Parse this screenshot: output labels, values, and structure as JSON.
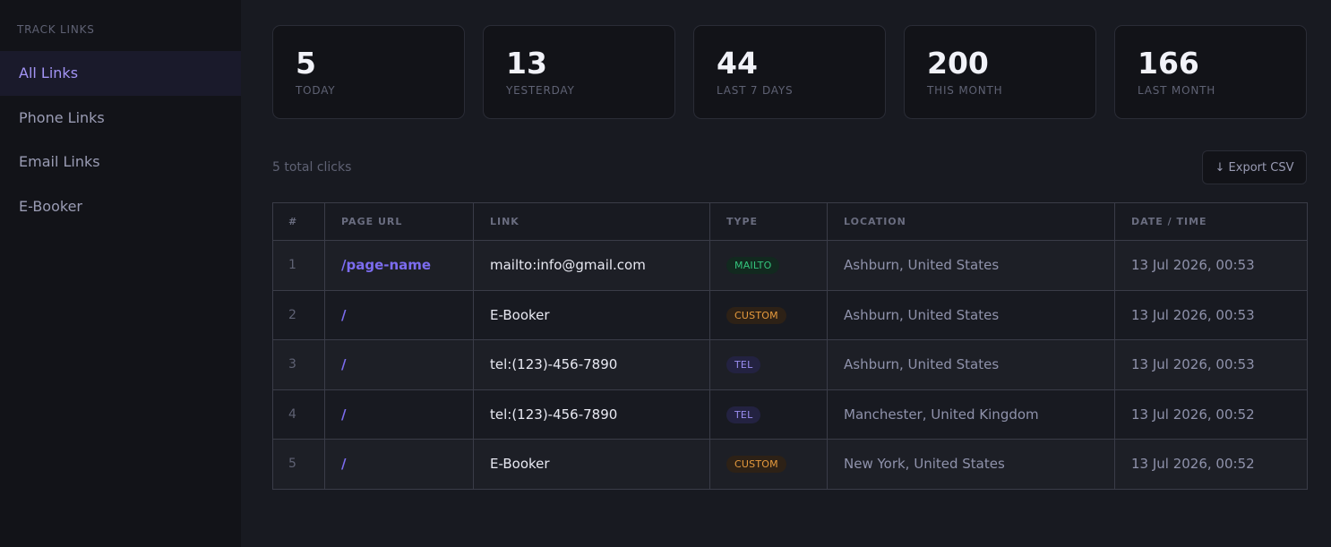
{
  "sidebar": {
    "heading": "TRACK LINKS",
    "items": [
      {
        "label": "All Links",
        "active": true
      },
      {
        "label": "Phone Links",
        "active": false
      },
      {
        "label": "Email Links",
        "active": false
      },
      {
        "label": "E-Booker",
        "active": false
      }
    ]
  },
  "stats": [
    {
      "value": "5",
      "label": "TODAY"
    },
    {
      "value": "13",
      "label": "YESTERDAY"
    },
    {
      "value": "44",
      "label": "LAST 7 DAYS"
    },
    {
      "value": "200",
      "label": "THIS MONTH"
    },
    {
      "value": "166",
      "label": "LAST MONTH"
    }
  ],
  "summary": {
    "total_clicks": "5 total clicks"
  },
  "toolbar": {
    "export_label": "↓ Export CSV"
  },
  "table": {
    "headers": [
      "#",
      "PAGE URL",
      "LINK",
      "TYPE",
      "LOCATION",
      "DATE / TIME"
    ],
    "rows": [
      {
        "idx": "1",
        "url": "/page-name",
        "link": "mailto:info@gmail.com",
        "type": "MAILTO",
        "location": "Ashburn, United States",
        "datetime": "13 Jul 2026, 00:53"
      },
      {
        "idx": "2",
        "url": "/",
        "link": "E-Booker",
        "type": "CUSTOM",
        "location": "Ashburn, United States",
        "datetime": "13 Jul 2026, 00:53"
      },
      {
        "idx": "3",
        "url": "/",
        "link": "tel:(123)-456-7890",
        "type": "TEL",
        "location": "Ashburn, United States",
        "datetime": "13 Jul 2026, 00:53"
      },
      {
        "idx": "4",
        "url": "/",
        "link": "tel:(123)-456-7890",
        "type": "TEL",
        "location": "Manchester, United Kingdom",
        "datetime": "13 Jul 2026, 00:52"
      },
      {
        "idx": "5",
        "url": "/",
        "link": "E-Booker",
        "type": "CUSTOM",
        "location": "New York, United States",
        "datetime": "13 Jul 2026, 00:52"
      }
    ]
  },
  "colors": {
    "accent": "#a394f5",
    "mailto": "#34c47c",
    "custom": "#e69a3d",
    "tel": "#9a8df0"
  }
}
